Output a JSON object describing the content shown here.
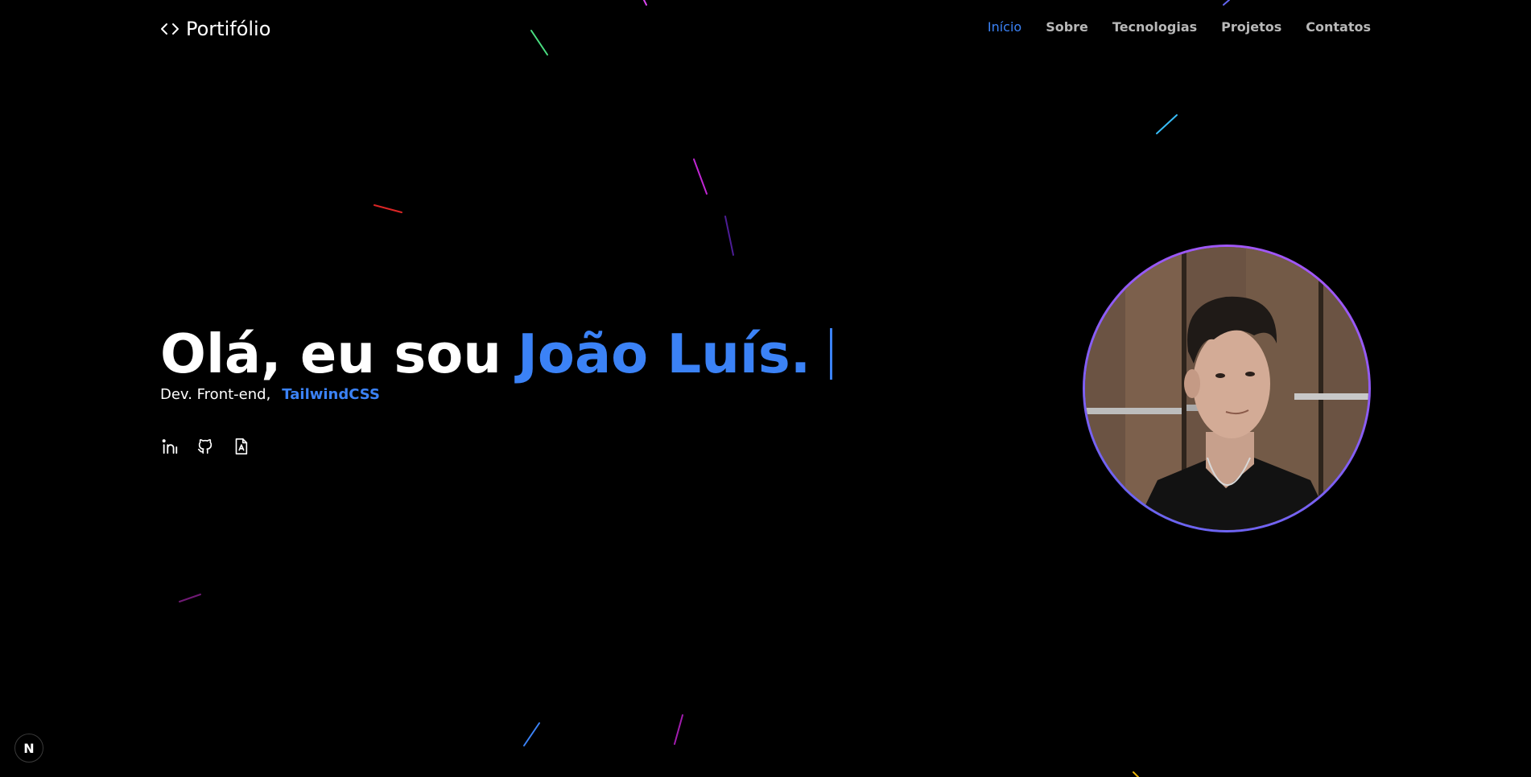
{
  "navbar": {
    "logo_text": "Portifólio",
    "links": [
      {
        "label": "Início",
        "active": true
      },
      {
        "label": "Sobre",
        "active": false
      },
      {
        "label": "Tecnologias",
        "active": false
      },
      {
        "label": "Projetos",
        "active": false
      },
      {
        "label": "Contatos",
        "active": false
      }
    ]
  },
  "hero": {
    "greeting": "Olá, eu sou",
    "name": "João Luís.",
    "role": "Dev. Front-end,",
    "typed_tech": "TailwindCSS"
  },
  "socials": [
    {
      "icon": "linkedin-icon"
    },
    {
      "icon": "github-icon"
    },
    {
      "icon": "resume-icon"
    }
  ],
  "badge": {
    "label": "N"
  },
  "colors": {
    "accent": "#3b82f6",
    "background": "#000000",
    "ring_gradient": [
      "#a855f7",
      "#6366f1"
    ]
  }
}
